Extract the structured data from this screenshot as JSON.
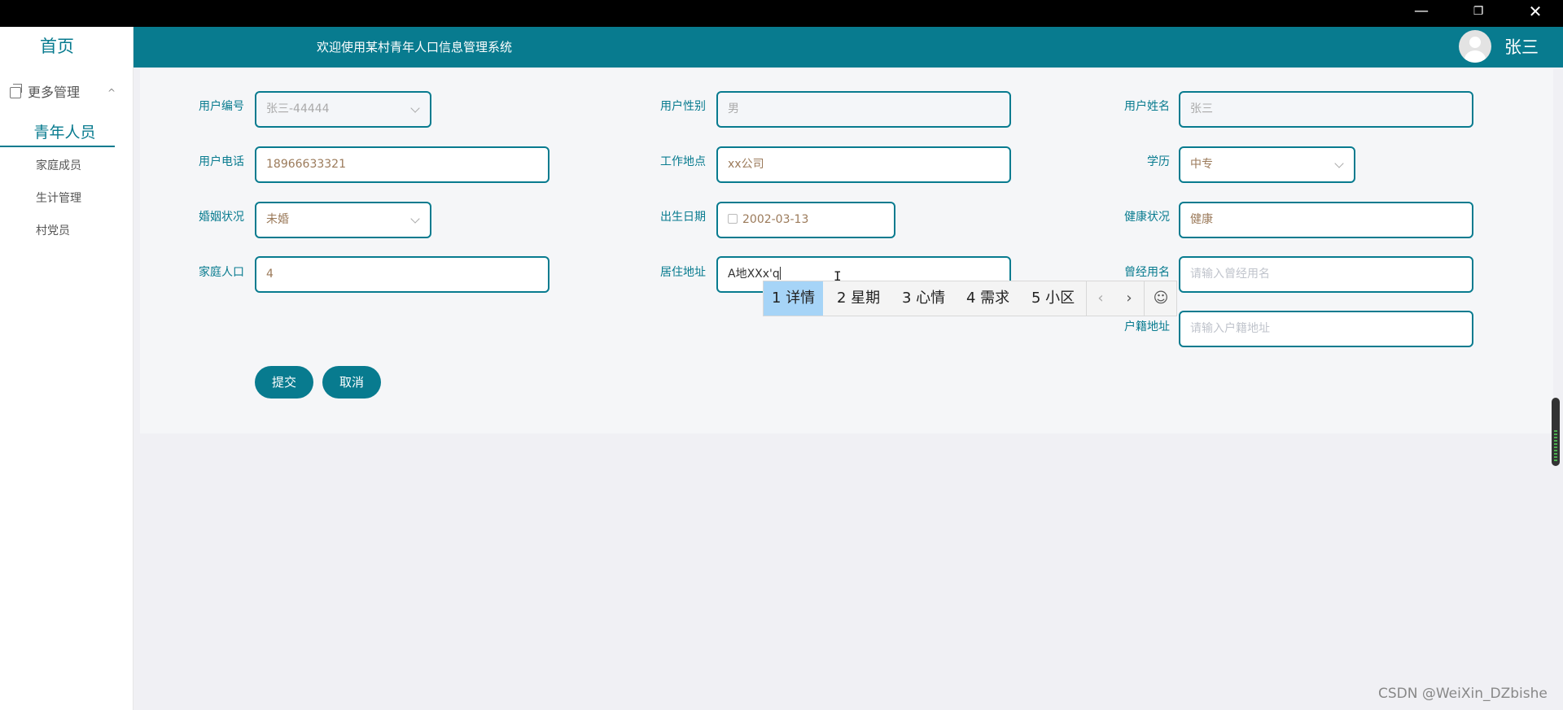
{
  "window": {
    "minimize": "—",
    "maximize": "❐",
    "close": "✕"
  },
  "sidebar": {
    "home": "首页",
    "group": "更多管理",
    "group_chevron": "^",
    "active": "青年人员",
    "items": [
      "家庭成员",
      "生计管理",
      "村党员"
    ]
  },
  "header": {
    "welcome": "欢迎使用某村青年人口信息管理系统",
    "username": "张三"
  },
  "form": {
    "user_id": {
      "label": "用户编号",
      "value": "张三-44444"
    },
    "gender": {
      "label": "用户性别",
      "value": "男"
    },
    "name": {
      "label": "用户姓名",
      "value": "张三"
    },
    "phone": {
      "label": "用户电话",
      "value": "18966633321"
    },
    "workplace": {
      "label": "工作地点",
      "value": "xx公司"
    },
    "education": {
      "label": "学历",
      "value": "中专"
    },
    "marital": {
      "label": "婚姻状况",
      "value": "未婚"
    },
    "birthdate": {
      "label": "出生日期",
      "value": "2002-03-13"
    },
    "health": {
      "label": "健康状况",
      "value": "健康"
    },
    "family_size": {
      "label": "家庭人口",
      "value": "4"
    },
    "residence": {
      "label": "居住地址",
      "value": "A地XXx'q"
    },
    "former_name": {
      "label": "曾经用名",
      "placeholder": "请输入曾经用名"
    },
    "household_addr": {
      "label": "户籍地址",
      "placeholder": "请输入户籍地址"
    },
    "submit": "提交",
    "cancel": "取消"
  },
  "ime": {
    "candidates": [
      "1 详情",
      "2 星期",
      "3 心情",
      "4 需求",
      "5 小区"
    ],
    "prev": "‹",
    "next": "›",
    "emoji": "☺"
  },
  "watermark": "CSDN @WeiXin_DZbishe",
  "colors": {
    "accent": "#087b8f",
    "ime_selected": "#a6d4f7"
  }
}
